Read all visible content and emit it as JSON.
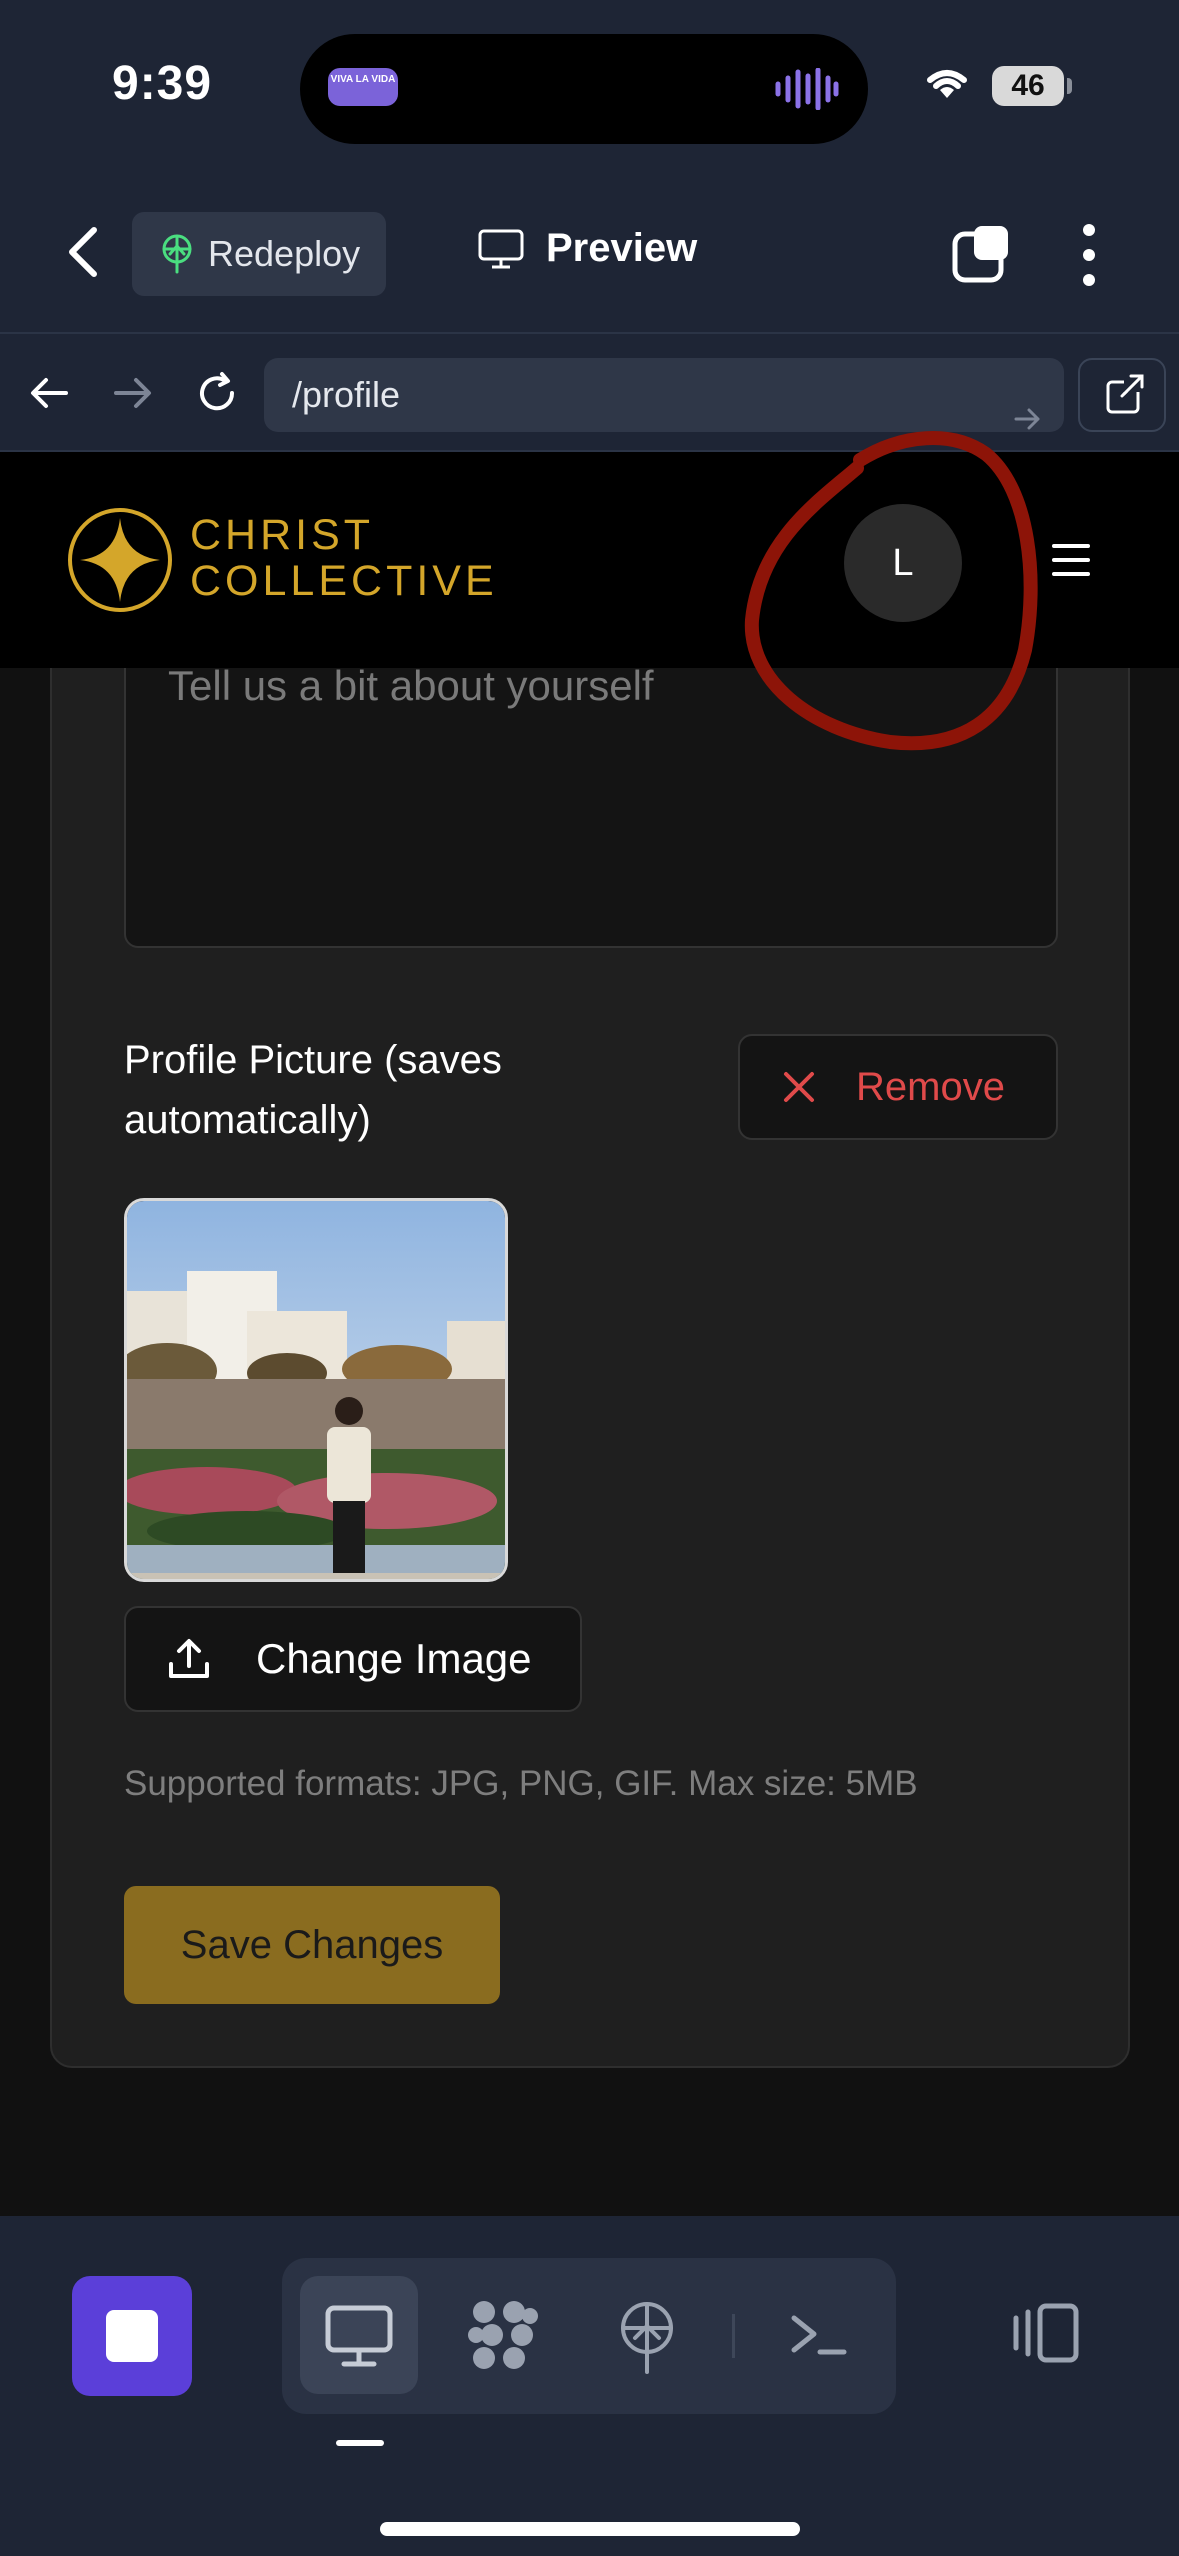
{
  "status_bar": {
    "time": "9:39",
    "battery": "46",
    "island_badge": "VIVA LA VIDA"
  },
  "app_header": {
    "redeploy_label": "Redeploy",
    "preview_label": "Preview"
  },
  "url_bar": {
    "path": "/profile"
  },
  "site_header": {
    "logo_line1": "CHRIST",
    "logo_line2": "COLLECTIVE",
    "avatar_initial": "L",
    "brand_color": "#d4a62a"
  },
  "profile_form": {
    "bio_placeholder": "Tell us a bit about yourself",
    "picture_label": "Profile Picture (saves automatically)",
    "remove_label": "Remove",
    "change_image_label": "Change Image",
    "formats_hint": "Supported formats: JPG, PNG, GIF. Max size: 5MB",
    "save_label": "Save Changes",
    "save_color": "#8a6c1f",
    "remove_color": "#e04a4a"
  },
  "bottom_toolbar": {
    "icons": [
      "stop-icon",
      "monitor-icon",
      "network-icon",
      "deploy-icon",
      "terminal-icon",
      "panel-icon"
    ],
    "accent": "#5b3fd9"
  }
}
